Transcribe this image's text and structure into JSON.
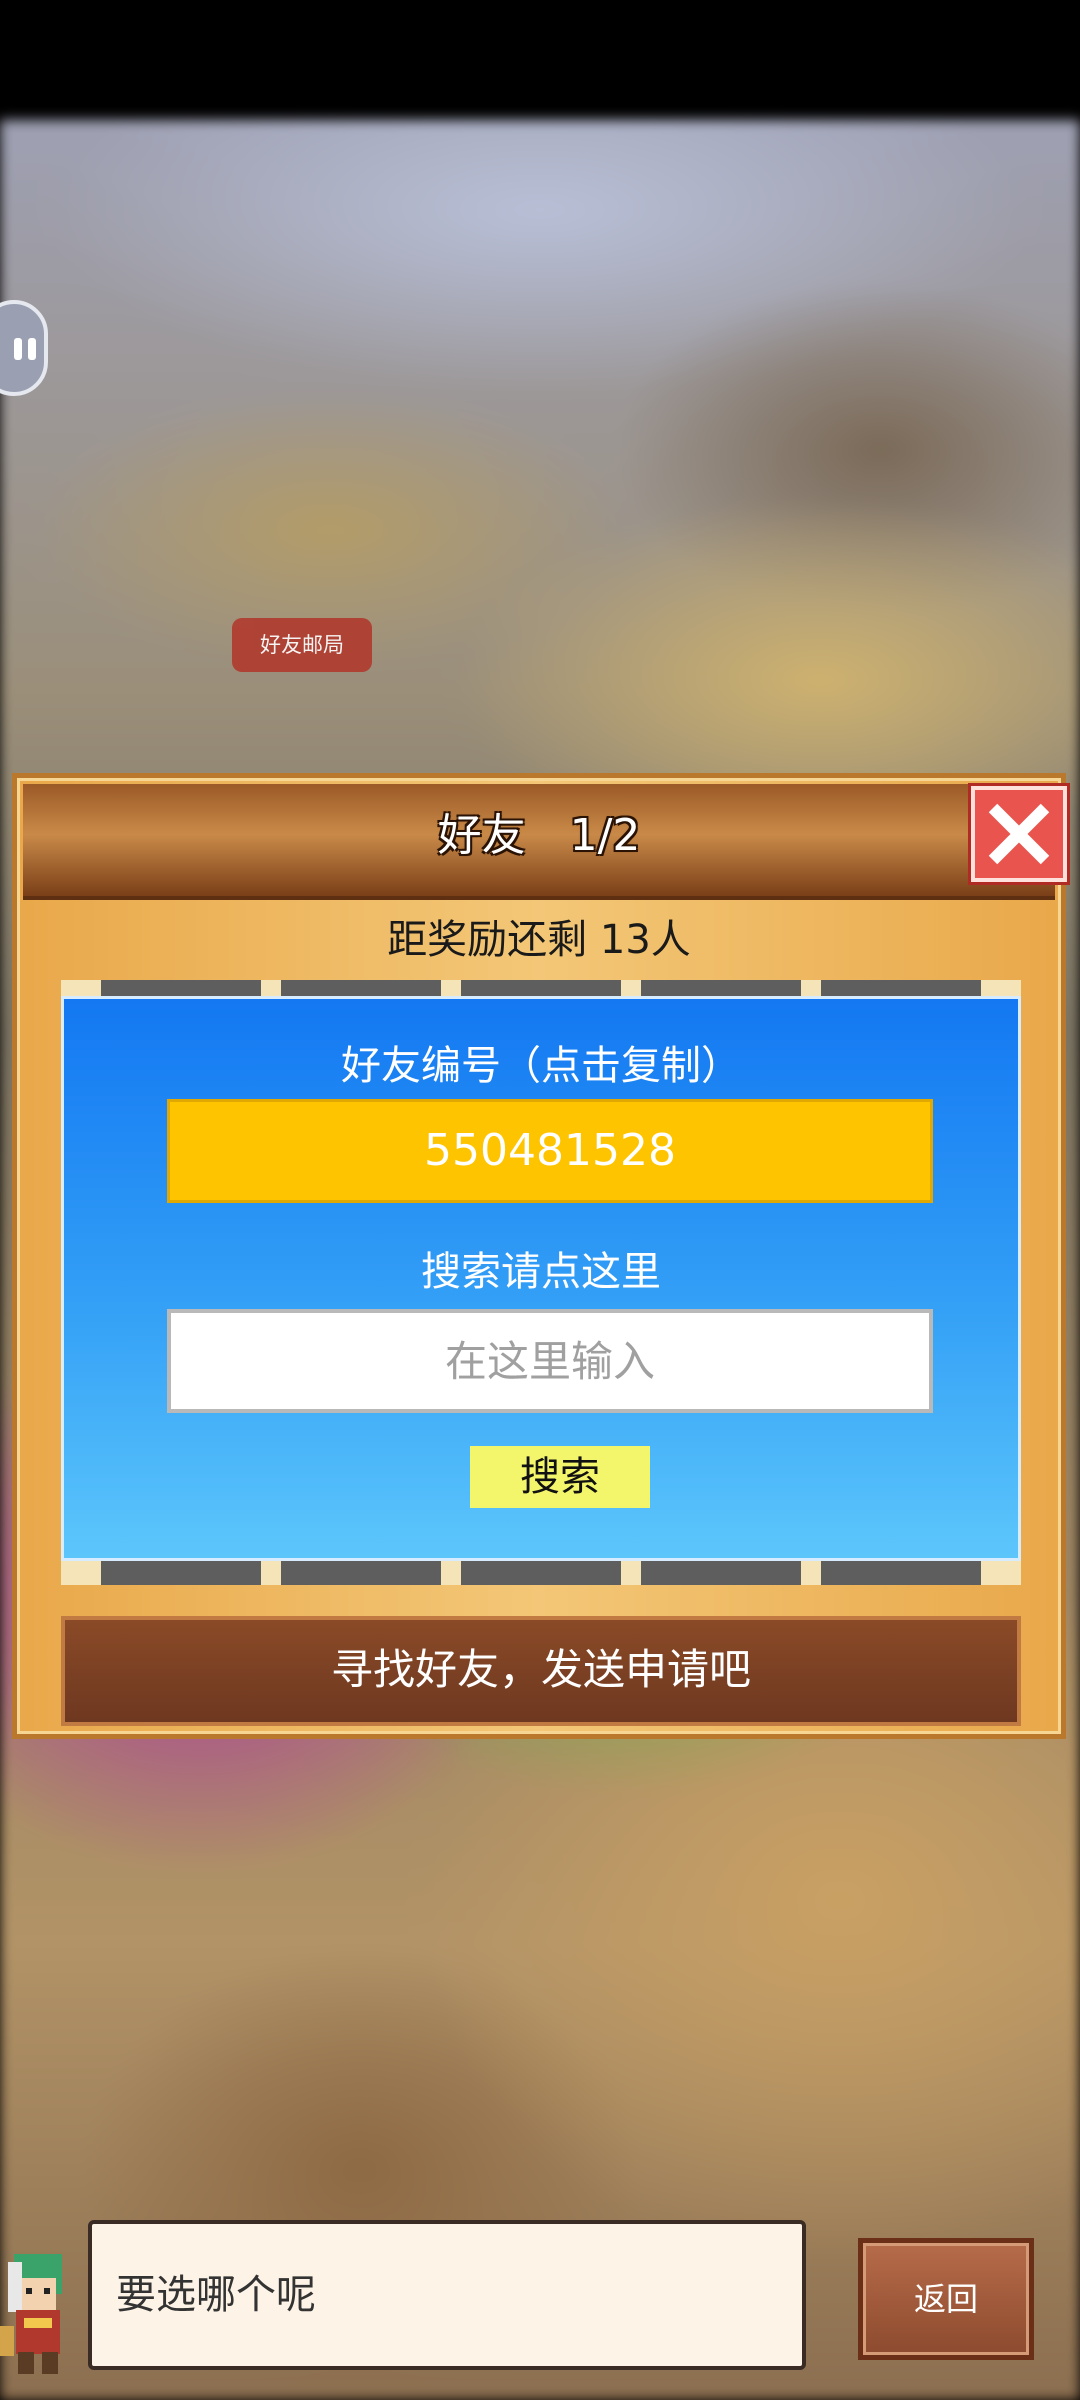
{
  "map": {
    "building_label": "好友邮局"
  },
  "dialog": {
    "title": "好友　1/2",
    "reward_text": "距奖励还剩 13人",
    "friend_id_label": "好友编号（点击复制）",
    "friend_id": "550481528",
    "search_label": "搜索请点这里",
    "search_placeholder": "在这里输入",
    "search_button": "搜索",
    "message": "寻找好友，发送申请吧"
  },
  "bottom": {
    "speech": "要选哪个呢",
    "back_button": "返回"
  },
  "colors": {
    "panel_blue": "#1378f2",
    "id_box": "#ffc400",
    "search_button": "#f3f56b",
    "close_button": "#e9544e"
  }
}
